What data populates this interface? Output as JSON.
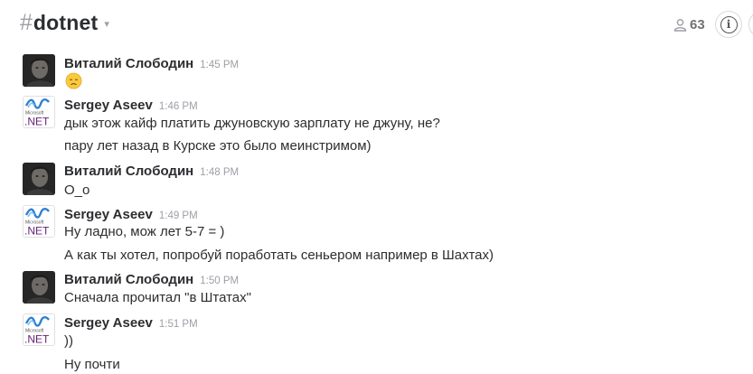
{
  "channel": {
    "hash": "#",
    "name": "dotnet",
    "caret": "⌄"
  },
  "members": {
    "count": "63",
    "icon": "person-icon"
  },
  "info": {
    "icon": "info-icon",
    "glyph": "i"
  },
  "messages": [
    {
      "author": "Виталий Слободин",
      "time": "1:45 PM",
      "avatar": "vitaly-photo",
      "emoji": "disappointed-face"
    },
    {
      "author": "Sergey Aseev",
      "time": "1:46 PM",
      "avatar": "microsoft-dotnet-logo",
      "lines": [
        "дык этож кайф платить джуновскую зарплату не джуну, не?",
        "пару лет назад в Курске это было меинстримом)"
      ]
    },
    {
      "author": "Виталий Слободин",
      "time": "1:48 PM",
      "avatar": "vitaly-photo",
      "lines": [
        "O_o"
      ]
    },
    {
      "author": "Sergey Aseev",
      "time": "1:49 PM",
      "avatar": "microsoft-dotnet-logo",
      "lines": [
        "Ну ладно, мож лет 5-7 = )",
        "А как ты хотел, попробуй поработать сеньером например в Шахтах)"
      ]
    },
    {
      "author": "Виталий Слободин",
      "time": "1:50 PM",
      "avatar": "vitaly-photo",
      "lines": [
        "Сначала прочитал \"в Штатах\""
      ]
    },
    {
      "author": "Sergey Aseev",
      "time": "1:51 PM",
      "avatar": "microsoft-dotnet-logo",
      "lines": [
        "))",
        "Ну почти"
      ]
    }
  ],
  "net_logo": {
    "brand": "Microsoft",
    "text": ".NET",
    "color": "#68217a",
    "wave_color": "#2e7fd1"
  }
}
